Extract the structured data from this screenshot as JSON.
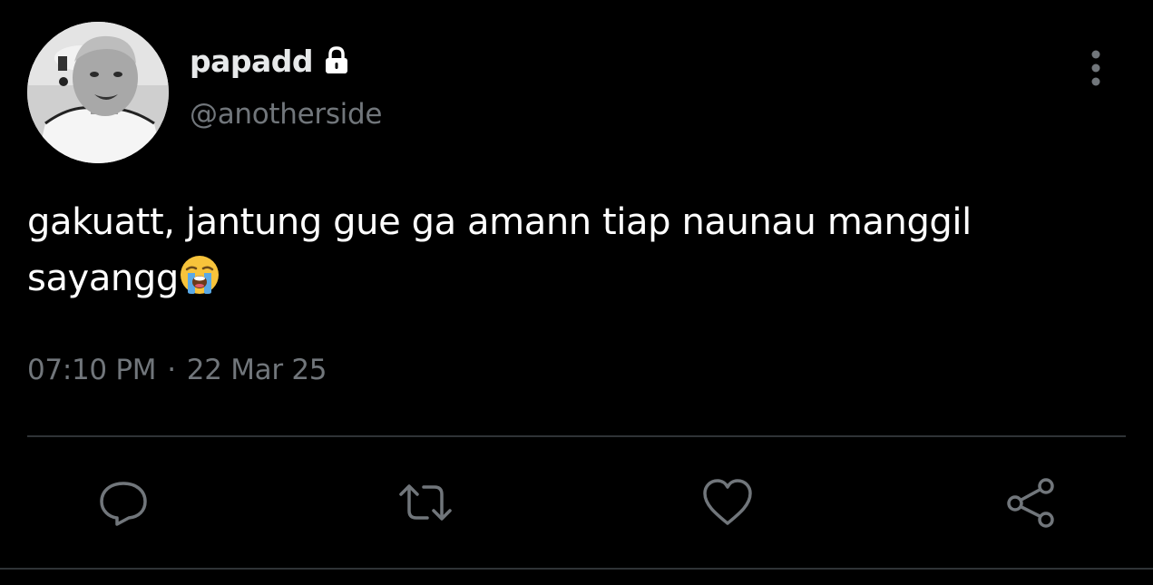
{
  "tweet": {
    "author": {
      "display_name": "papadd",
      "handle": "@anotherside",
      "locked_icon": "lock-icon",
      "avatar": "profile-photo"
    },
    "text_line1": "gakuatt, jantung gue ga amann tiap naunau manggil",
    "text_line2": "sayangg",
    "emoji": "loudly-crying-face",
    "time": "07:10 PM",
    "separator": "·",
    "date": "22 Mar 25",
    "more_icon": "more-vertical-icon",
    "actions": [
      {
        "icon": "reply-icon"
      },
      {
        "icon": "retweet-icon"
      },
      {
        "icon": "like-icon"
      },
      {
        "icon": "share-icon"
      }
    ]
  },
  "colors": {
    "background": "#000000",
    "text_primary": "#ffffff",
    "text_secondary": "#71767b",
    "divider": "#2f3336"
  }
}
